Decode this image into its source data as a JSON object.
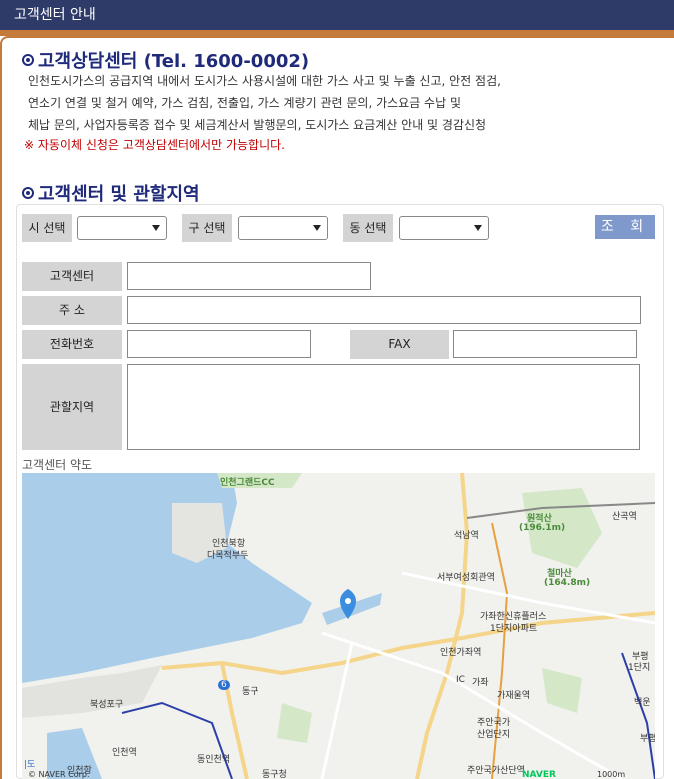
{
  "window": {
    "title": "고객센터 안내"
  },
  "consult": {
    "title": "고객상담센터 (Tel. 1600-0002)",
    "lines": [
      "인천도시가스의 공급지역 내에서 도시가스 사용시설에 대한 가스 사고 및 누출 신고, 안전 점검,",
      "연소기 연결 및 철거 예약, 가스 검침, 전출입, 가스 계량기 관련 문의, 가스요금 수납 및",
      "체납 문의, 사업자등록증 접수 및 세금계산서 발행문의, 도시가스 요금계산 안내 및 경감신청"
    ],
    "notice": "※ 자동이체 신청은 고객상담센터에서만 가능합니다."
  },
  "region": {
    "title": "고객센터 및 관할지역",
    "si_label": "시 선택",
    "gu_label": "구 선택",
    "dong_label": "동 선택",
    "search_button": "조 회",
    "center_label": "고객센터",
    "address_label": "주 소",
    "phone_label": "전화번호",
    "fax_label": "FAX",
    "area_label": "관할지역",
    "map_caption": "고객센터 약도"
  },
  "map": {
    "labels": {
      "grand": "인천그랜드CC",
      "pier": "인천북항",
      "pier2": "다목적부두",
      "seoknam": "석남역",
      "wonjeok": "원적산",
      "wonjeok_h": "(196.1m)",
      "cheolma": "철마산",
      "cheolma_h": "(164.8m)",
      "sangok": "산곡역",
      "seobu": "서부여성회관역",
      "apt1": "가좌한신휴플러스",
      "apt2": "1단지아파트",
      "gajwa_st": "인천가좌역",
      "gajwa": "가좌",
      "gajaeul": "가재울역",
      "jooan1": "주안국가",
      "jooan2": "산업단지",
      "jooan_st": "주안국가산단역",
      "bukseong": "북성포구",
      "donggu": "동구",
      "incheon_st": "인천역",
      "dongincheon": "동인천역",
      "incheon_port": "인천항",
      "dong_office": "동구청",
      "route6": "6",
      "ic": "IC",
      "bupyeong1": "부평",
      "bupyeong2": "1단지",
      "baekun": "백운",
      "bupyeong3": "부평",
      "naver": "© NAVER Corp.",
      "naver_logo": "NAVER",
      "scale": "1000m",
      "do": "|도"
    },
    "colors": {
      "water": "#aacdea",
      "road_major": "#f4d58a",
      "road": "#ffffff",
      "park": "#d4e8c8",
      "marker": "#3b8de0"
    }
  }
}
